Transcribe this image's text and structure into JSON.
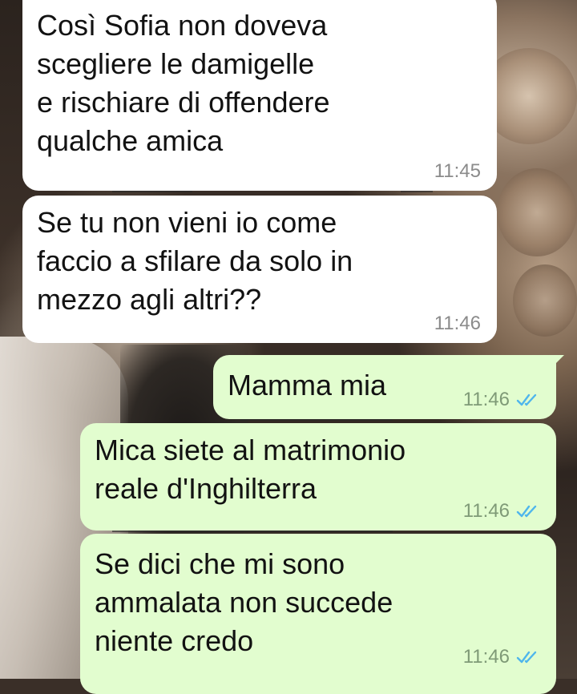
{
  "messages": [
    {
      "direction": "incoming",
      "text": "Così Sofia non doveva\nscegliere le damigelle\ne rischiare di offendere\nqualche amica",
      "time": "11:45"
    },
    {
      "direction": "incoming",
      "text": "Se tu non vieni io come\nfaccio a sfilare da solo in\nmezzo agli altri??",
      "time": "11:46"
    },
    {
      "direction": "outgoing",
      "text": "Mamma mia",
      "time": "11:46",
      "status_icon": "read-double-check-icon"
    },
    {
      "direction": "outgoing",
      "text": "Mica siete al matrimonio\nreale d'Inghilterra",
      "time": "11:46",
      "status_icon": "read-double-check-icon"
    },
    {
      "direction": "outgoing",
      "text": "Se dici che mi sono\nammalata non succede\nniente credo",
      "time": "11:46",
      "status_icon": "read-double-check-icon"
    }
  ],
  "colors": {
    "incoming_bubble": "#ffffff",
    "outgoing_bubble": "#e2fdcf",
    "read_ticks": "#4fb6ec",
    "timestamp": "#8b8b8b"
  }
}
